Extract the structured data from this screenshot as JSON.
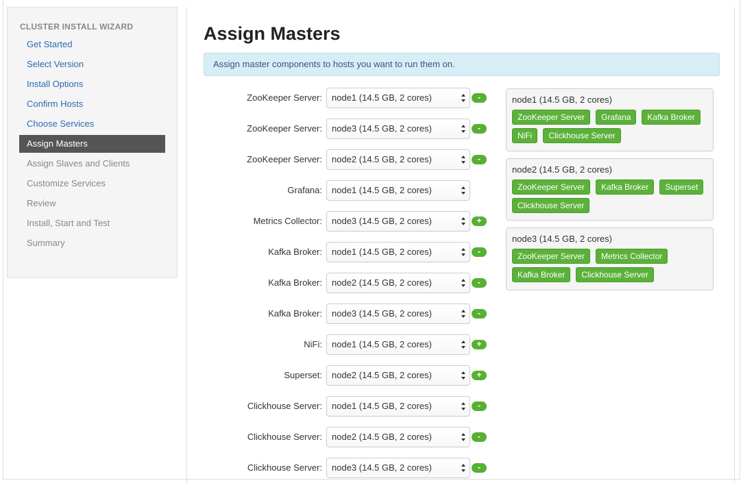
{
  "sidebar": {
    "header": "CLUSTER INSTALL WIZARD",
    "items": [
      {
        "label": "Get Started",
        "state": "done"
      },
      {
        "label": "Select Version",
        "state": "done"
      },
      {
        "label": "Install Options",
        "state": "done"
      },
      {
        "label": "Confirm Hosts",
        "state": "done"
      },
      {
        "label": "Choose Services",
        "state": "done"
      },
      {
        "label": "Assign Masters",
        "state": "active"
      },
      {
        "label": "Assign Slaves and Clients",
        "state": "pending"
      },
      {
        "label": "Customize Services",
        "state": "pending"
      },
      {
        "label": "Review",
        "state": "pending"
      },
      {
        "label": "Install, Start and Test",
        "state": "pending"
      },
      {
        "label": "Summary",
        "state": "pending"
      }
    ]
  },
  "main": {
    "title": "Assign Masters",
    "alert": "Assign master components to hosts you want to run them on."
  },
  "assignments": [
    {
      "label": "ZooKeeper Server:",
      "host": "node1 (14.5 GB, 2 cores)",
      "action": "-"
    },
    {
      "label": "ZooKeeper Server:",
      "host": "node3 (14.5 GB, 2 cores)",
      "action": "-"
    },
    {
      "label": "ZooKeeper Server:",
      "host": "node2 (14.5 GB, 2 cores)",
      "action": "-"
    },
    {
      "label": "Grafana:",
      "host": "node1 (14.5 GB, 2 cores)",
      "action": ""
    },
    {
      "label": "Metrics Collector:",
      "host": "node3 (14.5 GB, 2 cores)",
      "action": "+"
    },
    {
      "label": "Kafka Broker:",
      "host": "node1 (14.5 GB, 2 cores)",
      "action": "-"
    },
    {
      "label": "Kafka Broker:",
      "host": "node2 (14.5 GB, 2 cores)",
      "action": "-"
    },
    {
      "label": "Kafka Broker:",
      "host": "node3 (14.5 GB, 2 cores)",
      "action": "-"
    },
    {
      "label": "NiFi:",
      "host": "node1 (14.5 GB, 2 cores)",
      "action": "+"
    },
    {
      "label": "Superset:",
      "host": "node2 (14.5 GB, 2 cores)",
      "action": "+"
    },
    {
      "label": "Clickhouse Server:",
      "host": "node1 (14.5 GB, 2 cores)",
      "action": "-"
    },
    {
      "label": "Clickhouse Server:",
      "host": "node2 (14.5 GB, 2 cores)",
      "action": "-"
    },
    {
      "label": "Clickhouse Server:",
      "host": "node3 (14.5 GB, 2 cores)",
      "action": "-"
    }
  ],
  "hosts": [
    {
      "name": "node1 (14.5 GB, 2 cores)",
      "components": [
        "ZooKeeper Server",
        "Grafana",
        "Kafka Broker",
        "NiFi",
        "Clickhouse Server"
      ]
    },
    {
      "name": "node2 (14.5 GB, 2 cores)",
      "components": [
        "ZooKeeper Server",
        "Kafka Broker",
        "Superset",
        "Clickhouse Server"
      ]
    },
    {
      "name": "node3 (14.5 GB, 2 cores)",
      "components": [
        "ZooKeeper Server",
        "Metrics Collector",
        "Kafka Broker",
        "Clickhouse Server"
      ]
    }
  ],
  "colors": {
    "accent_green": "#5cb13a",
    "active_nav": "#555555",
    "link": "#2a6ab2",
    "alert_bg": "#d9edf7"
  }
}
